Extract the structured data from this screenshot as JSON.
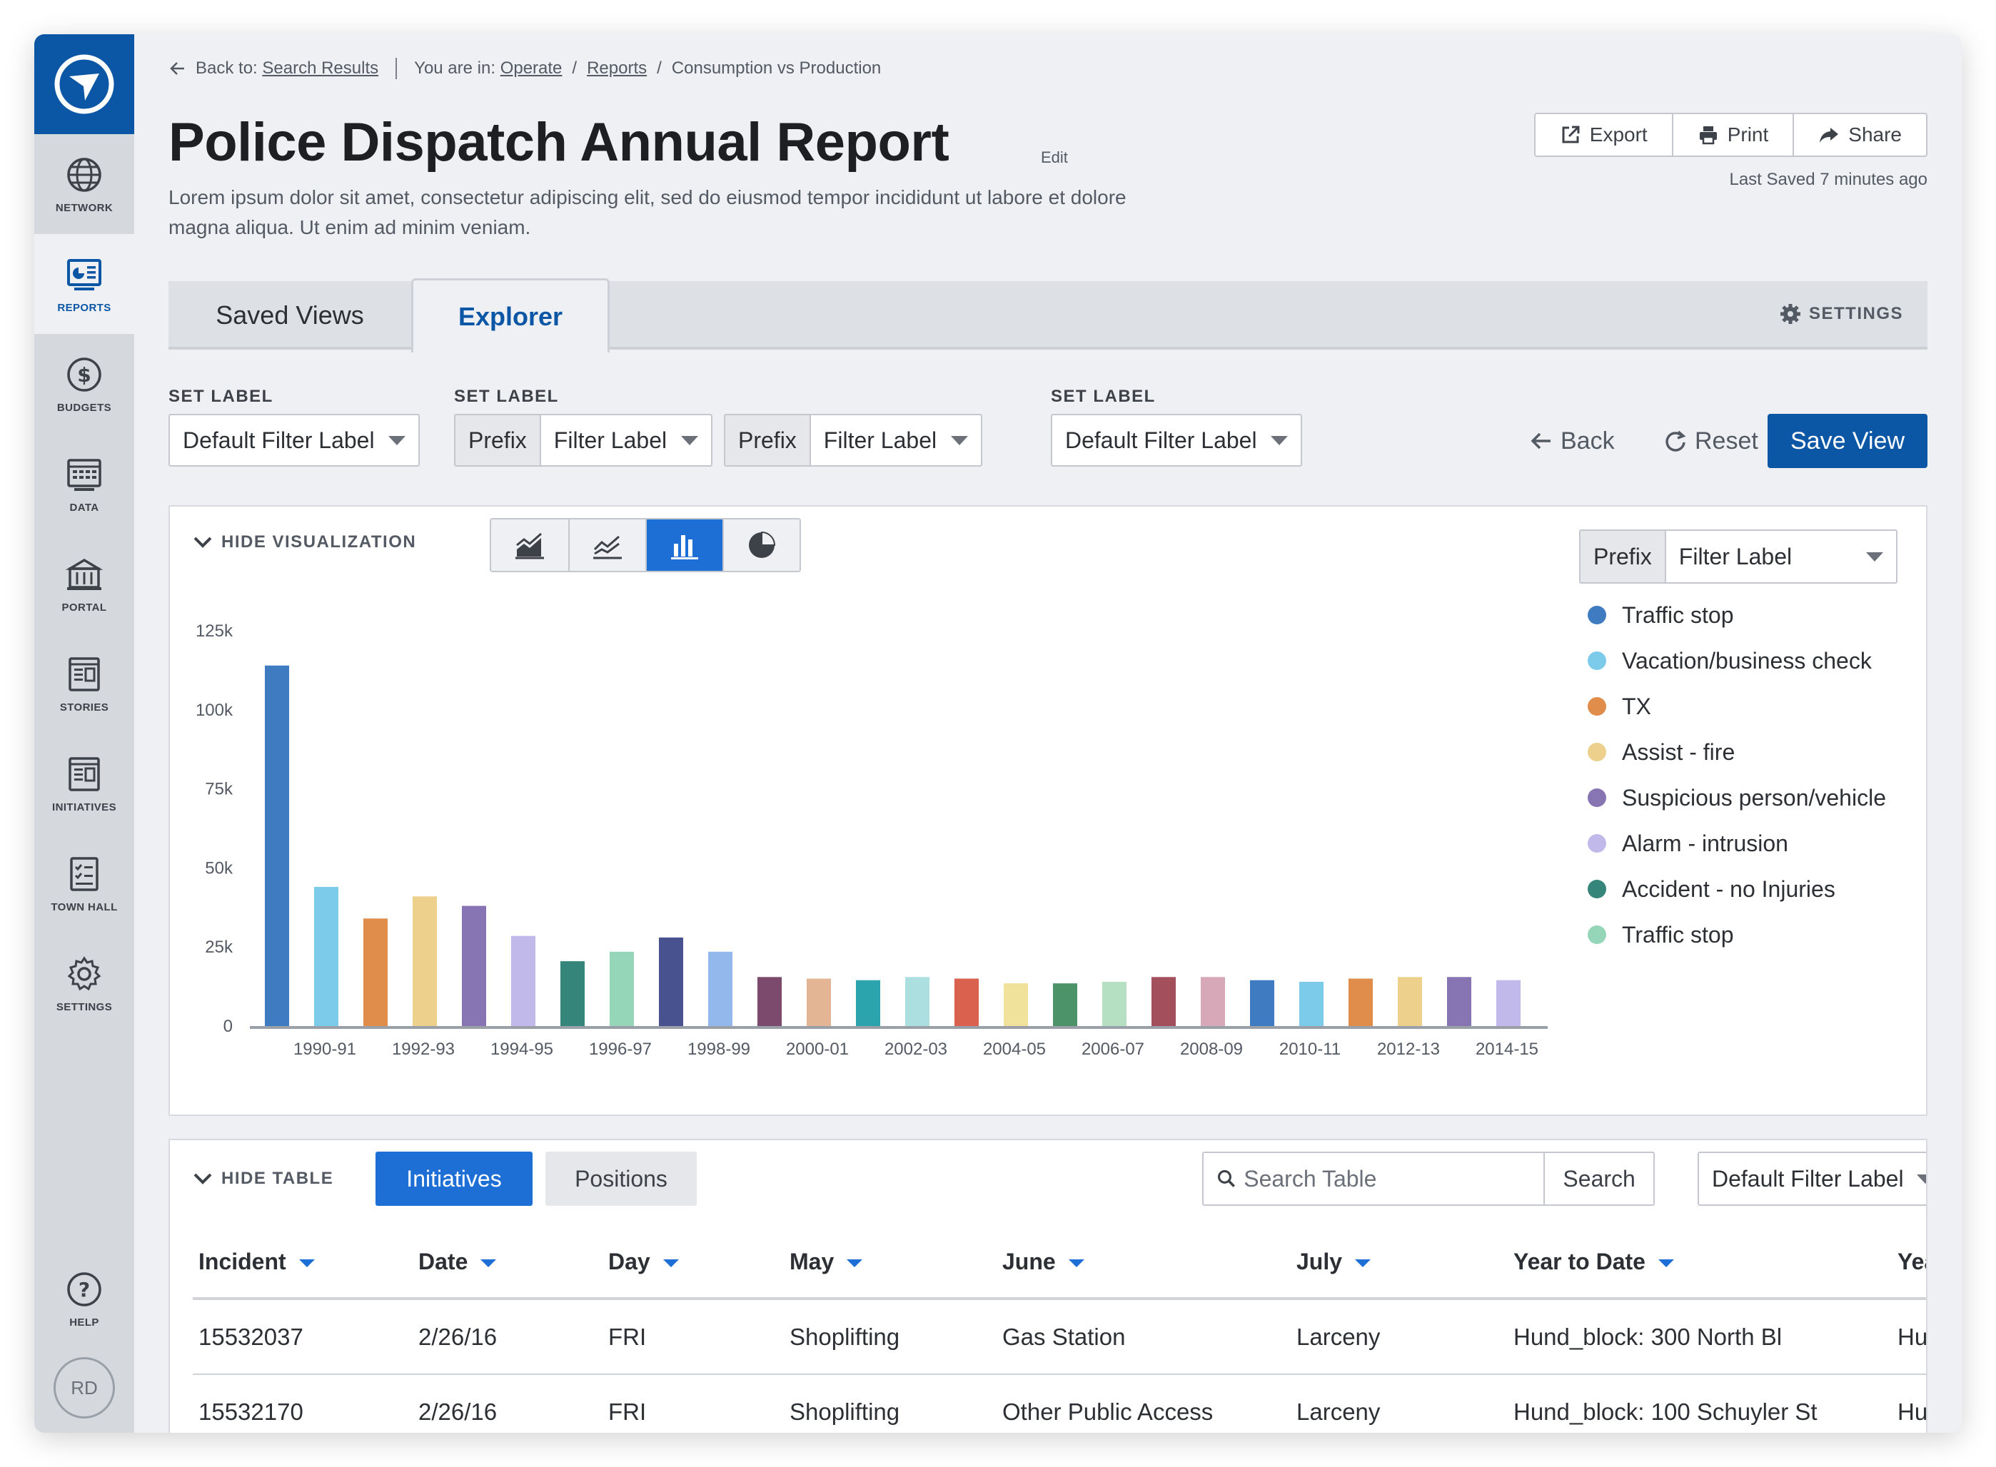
{
  "sidebar": {
    "items": [
      {
        "label": "NETWORK",
        "icon": "globe-icon"
      },
      {
        "label": "REPORTS",
        "icon": "reports-icon",
        "active": true
      },
      {
        "label": "BUDGETS",
        "icon": "dollar-icon"
      },
      {
        "label": "DATA",
        "icon": "data-grid-icon"
      },
      {
        "label": "PORTAL",
        "icon": "building-icon"
      },
      {
        "label": "STORIES",
        "icon": "stories-icon"
      },
      {
        "label": "INITIATIVES",
        "icon": "initiatives-icon"
      },
      {
        "label": "TOWN HALL",
        "icon": "checklist-icon"
      },
      {
        "label": "SETTINGS",
        "icon": "gear-icon"
      }
    ],
    "help": {
      "label": "HELP",
      "icon": "help-icon"
    },
    "avatar": "RD",
    "brand_color": "#0b57a6"
  },
  "breadcrumb": {
    "back_prefix": "Back to:",
    "back_link": "Search Results",
    "location_prefix": "You are in:",
    "crumbs": [
      "Operate",
      "Reports"
    ],
    "current": "Consumption vs Production"
  },
  "header": {
    "title": "Police Dispatch Annual Report",
    "edit": "Edit",
    "description": "Lorem ipsum dolor sit amet, consectetur adipiscing elit, sed do eiusmod tempor incididunt ut labore et dolore magna aliqua. Ut enim ad minim veniam.",
    "actions": [
      {
        "label": "Export",
        "icon": "external-link-icon"
      },
      {
        "label": "Print",
        "icon": "printer-icon"
      },
      {
        "label": "Share",
        "icon": "share-arrow-icon"
      }
    ],
    "last_saved": "Last Saved 7 minutes ago"
  },
  "tabs": {
    "saved_views": "Saved Views",
    "explorer": "Explorer",
    "active": "Explorer",
    "settings": "SETTINGS"
  },
  "filters": {
    "set_labels": [
      "SET LABEL",
      "SET LABEL",
      "SET LABEL"
    ],
    "select_1": {
      "value": "Default Filter Label"
    },
    "select_2": {
      "prefix": "Prefix",
      "value": "Filter Label"
    },
    "select_3": {
      "prefix": "Prefix",
      "value": "Filter Label"
    },
    "select_4": {
      "value": "Default Filter Label"
    },
    "back": "Back",
    "reset": "Reset",
    "save_view": "Save View"
  },
  "visualization": {
    "hide_label": "HIDE VISUALIZATION",
    "chart_types": [
      "area-chart-icon",
      "line-chart-icon",
      "bar-chart-icon",
      "pie-chart-icon"
    ],
    "active_chart_type": "bar-chart-icon",
    "legend_select": {
      "prefix": "Prefix",
      "value": "Filter Label"
    },
    "legend": [
      {
        "label": "Traffic stop",
        "color": "#3f7bc0"
      },
      {
        "label": "Vacation/business check",
        "color": "#7ccbea"
      },
      {
        "label": "TX",
        "color": "#e08c4b"
      },
      {
        "label": "Assist - fire",
        "color": "#ecd08c"
      },
      {
        "label": "Suspicious person/vehicle",
        "color": "#8774b3"
      },
      {
        "label": "Alarm - intrusion",
        "color": "#c1b9ea"
      },
      {
        "label": "Accident - no Injuries",
        "color": "#35857a"
      },
      {
        "label": "Traffic stop",
        "color": "#95d5b8"
      }
    ]
  },
  "chart_data": {
    "type": "bar",
    "ylim": [
      0,
      125000
    ],
    "yticks": [
      0,
      25000,
      50000,
      75000,
      100000,
      125000
    ],
    "ytick_labels": [
      "0",
      "25k",
      "50k",
      "75k",
      "100k",
      "125k"
    ],
    "xtick_labels": [
      "1990-91",
      "1992-93",
      "1994-95",
      "1996-97",
      "1998-99",
      "2000-01",
      "2002-03",
      "2004-05",
      "2006-07",
      "2008-09",
      "2010-11",
      "2012-13",
      "2014-15"
    ],
    "values": [
      114000,
      44000,
      34000,
      41000,
      38000,
      28500,
      20500,
      23500,
      28000,
      23500,
      15500,
      15000,
      14500,
      15500,
      15000,
      13500,
      13500,
      14000,
      15500,
      15500,
      14500,
      14000,
      15000,
      15500,
      15500,
      14500
    ],
    "colors": [
      "#3f7bc0",
      "#7ccbea",
      "#e08c4b",
      "#ecd08c",
      "#8774b3",
      "#c1b9ea",
      "#35857a",
      "#95d5b8",
      "#47528f",
      "#93b9ec",
      "#7b4a6c",
      "#e4b594",
      "#2ba4ae",
      "#acdfe0",
      "#d9614e",
      "#f0e29a",
      "#4c9369",
      "#b5e0c2",
      "#a3505c",
      "#d7a9b8",
      "#3f7bc0",
      "#7ccbea",
      "#e08c4b",
      "#ecd08c",
      "#8774b3",
      "#c1b9ea"
    ],
    "grid": false
  },
  "table": {
    "hide_label": "HIDE TABLE",
    "tabs": [
      "Initiatives",
      "Positions"
    ],
    "active_tab": "Initiatives",
    "search_placeholder": "Search Table",
    "search_button": "Search",
    "filter": {
      "value": "Default Filter Label"
    },
    "columns": [
      "Incident",
      "Date",
      "Day",
      "May",
      "June",
      "July",
      "Year to Date",
      "Year"
    ],
    "rows": [
      [
        "15532037",
        "2/26/16",
        "FRI",
        "Shoplifting",
        "Gas Station",
        "Larceny",
        "Hund_block: 300 North Bl",
        "Hund_block"
      ],
      [
        "15532170",
        "2/26/16",
        "FRI",
        "Shoplifting",
        "Other Public Access",
        "Larceny",
        "Hund_block: 100 Schuyler St",
        "Hund_block"
      ]
    ]
  }
}
